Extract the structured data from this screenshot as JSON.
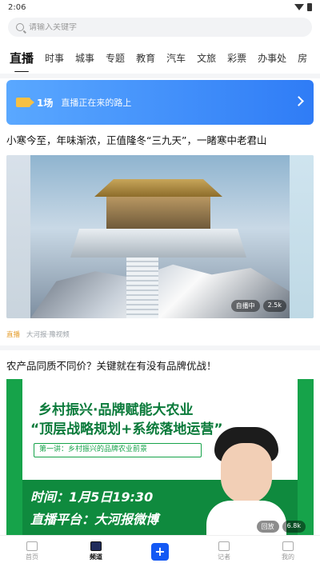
{
  "status": {
    "time": "2:06"
  },
  "search": {
    "placeholder": "请输入关键字"
  },
  "tabs": [
    "直播",
    "时事",
    "城事",
    "专题",
    "教育",
    "汽车",
    "文旅",
    "彩票",
    "办事处",
    "房"
  ],
  "live_banner": {
    "count": "1场",
    "text": "直播正在来的路上"
  },
  "articles": [
    {
      "title": "小寒今至，年味渐浓，正值隆冬“三九天”，一睹寒中老君山",
      "overlay": [
        "自播中",
        "2.5k"
      ],
      "tag": "直播",
      "source": "大河报·豫视频"
    },
    {
      "title": "农产品同质不同价？关键就在有没有品牌优战！",
      "promo": {
        "title": "乡村振兴·品牌赋能大农业",
        "subtitle": "“顶层战略规划+系统落地运营”",
        "lecture": "第一讲：乡村振兴的品牌农业前景",
        "time": "时间：1月5日19:30",
        "platform": "直播平台：大河报微博"
      },
      "overlay": [
        "回放",
        "6.8k"
      ]
    }
  ],
  "bottom_nav": [
    "首页",
    "频道",
    "+",
    "记者",
    "我的"
  ],
  "colors": {
    "accent": "#1459f4",
    "banner": "#3b82f6",
    "promo_green": "#16a34a"
  }
}
